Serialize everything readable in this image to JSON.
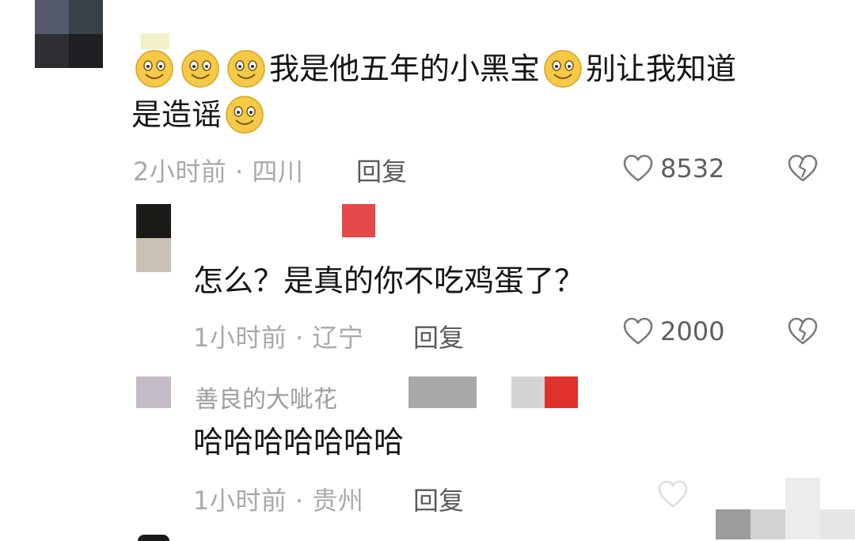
{
  "comments": [
    {
      "text_parts": [
        "我是他五年的小黑宝",
        "别让我知道",
        "是造谣"
      ],
      "time": "2小时前",
      "location": "四川",
      "reply_label": "回复",
      "likes": "8532"
    },
    {
      "text": "怎么？是真的你不吃鸡蛋了？",
      "time": "1小时前",
      "location": "辽宁",
      "reply_label": "回复",
      "likes": "2000"
    },
    {
      "username": "善良的大呲花",
      "text": "哈哈哈哈哈哈哈",
      "time": "1小时前",
      "location": "贵州",
      "reply_label": "回复"
    }
  ],
  "meta_separator": "·",
  "icons": {
    "emoji": "smiley-face-icon",
    "like": "heart-outline-icon",
    "dislike": "broken-heart-icon"
  },
  "colors": {
    "emoji_fill": "#f7c948",
    "mosaic_red": "#e0322d"
  }
}
